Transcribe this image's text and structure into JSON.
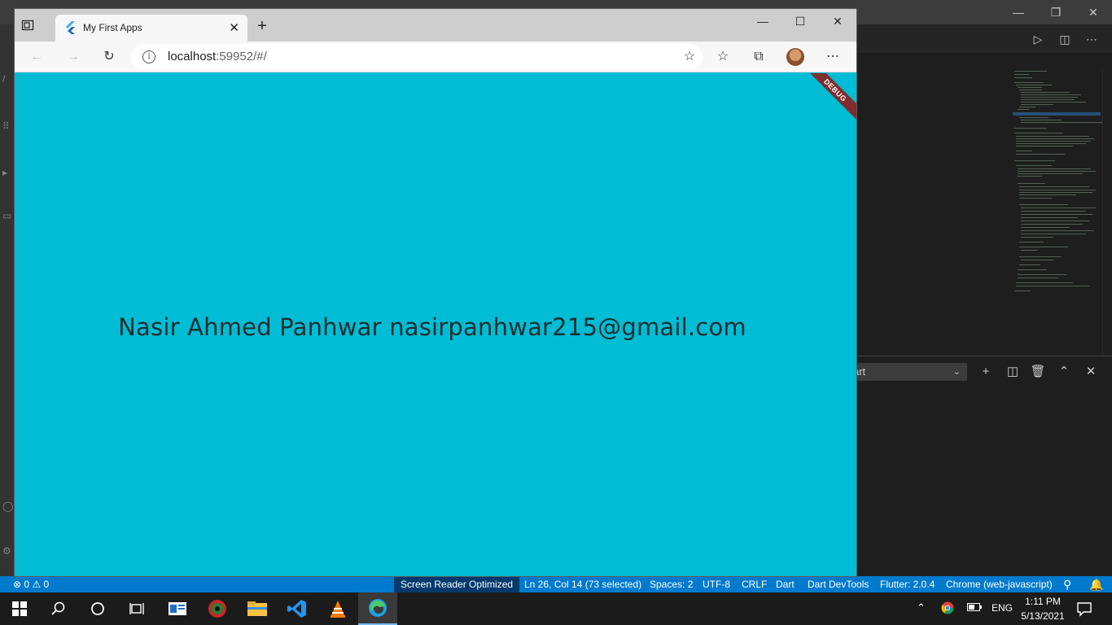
{
  "browser": {
    "tab_title": "My First Apps",
    "url_host": "localhost",
    "url_rest": ":59952/#/",
    "window_controls": {
      "minimize": "—",
      "maximize": "☐",
      "close": "✕"
    }
  },
  "app": {
    "main_text": "Nasir Ahmed Panhwar nasirpanhwar215@gmail.com",
    "debug_banner": "DEBUG",
    "background_color": "#00bcd4"
  },
  "vscode": {
    "panel_select": "art",
    "status": {
      "problems": "⊗ 0 ⚠ 0",
      "screen_reader": "Screen Reader Optimized",
      "cursor": "Ln 26, Col 14 (73 selected)",
      "spaces": "Spaces: 2",
      "encoding": "UTF-8",
      "eol": "CRLF",
      "language": "Dart",
      "devtools": "Dart DevTools",
      "flutter": "Flutter: 2.0.4",
      "device": "Chrome (web-javascript)"
    }
  },
  "taskbar": {
    "lang": "ENG",
    "time": "1:11 PM",
    "date": "5/13/2021"
  }
}
